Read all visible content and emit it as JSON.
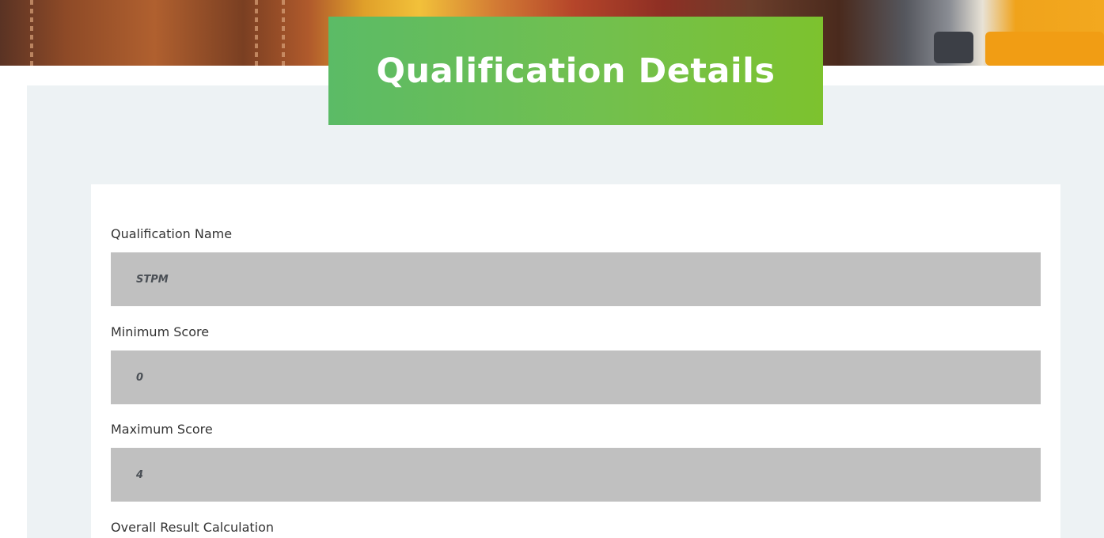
{
  "header": {
    "title": "Qualification Details"
  },
  "form": {
    "fields": [
      {
        "label": "Qualification Name",
        "value": "STPM"
      },
      {
        "label": "Minimum Score",
        "value": "0"
      },
      {
        "label": "Maximum Score",
        "value": "4"
      },
      {
        "label": "Overall Result Calculation",
        "value": ""
      }
    ]
  },
  "colors": {
    "title_gradient_start": "#5bbb66",
    "title_gradient_end": "#7dc22e",
    "panel_background": "#edf2f4",
    "field_background": "#c0c0c0"
  },
  "icons": {
    "hero": "hero-banner-photo"
  }
}
